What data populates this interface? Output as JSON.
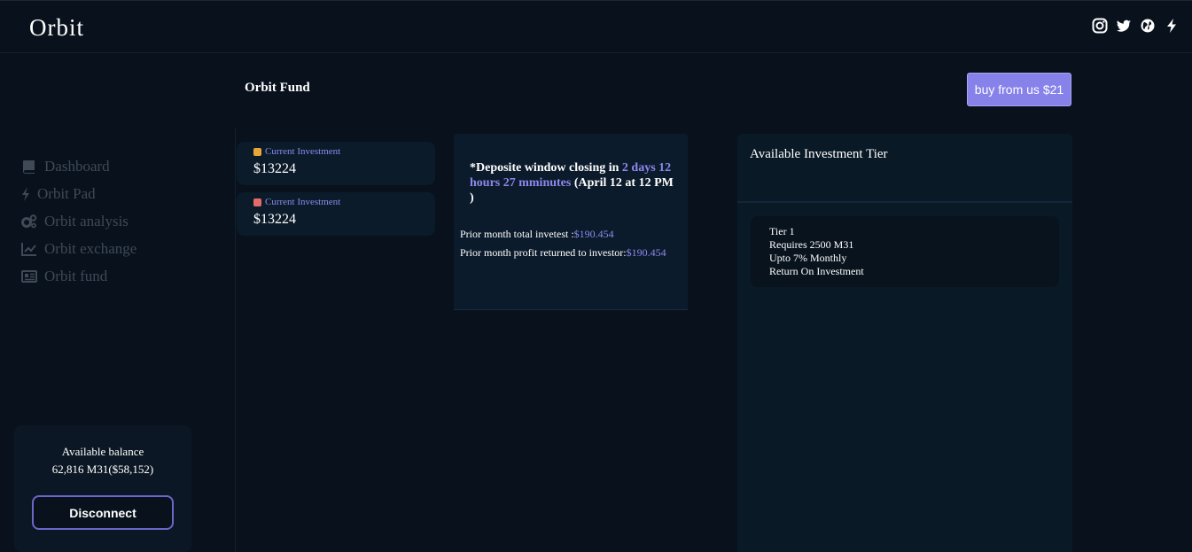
{
  "app": {
    "brand": "Orbit"
  },
  "social": [
    {
      "icon": "instagram-icon"
    },
    {
      "icon": "twitter-icon"
    },
    {
      "icon": "globe-icon"
    },
    {
      "icon": "bolt-icon"
    }
  ],
  "sidebar": {
    "items": [
      {
        "label": "Dashboard",
        "icon": "book-icon"
      },
      {
        "label": "Orbit Pad",
        "icon": "bolt-icon"
      },
      {
        "label": "Orbit analysis",
        "icon": "gears-icon"
      },
      {
        "label": "Orbit exchange",
        "icon": "line-chart-icon"
      },
      {
        "label": "Orbit fund",
        "icon": "newspaper-icon"
      }
    ],
    "balance": {
      "label": "Available balance",
      "value": "62,816 M31($58,152)",
      "disconnect_label": "Disconnect"
    }
  },
  "header": {
    "title": "Orbit Fund",
    "buy_label": "buy from us $21"
  },
  "investments": [
    {
      "label": "Current Investment",
      "value": "$13224",
      "icon_color": "#e8a53a"
    },
    {
      "label": "Current Investment",
      "value": "$13224",
      "icon_color": "#e36b6b"
    }
  ],
  "deposit": {
    "prefix": "*Deposite window closing in ",
    "countdown": "2 days 12 hours 27 mminutes",
    "suffix": " (April 12 at 12 PM )",
    "prior_total_label": "Prior month total invetest :",
    "prior_total_value": "$190.454",
    "prior_profit_label": "Prior month profit returned to investor:",
    "prior_profit_value": "$190.454"
  },
  "tiers": {
    "heading": "Available Investment Tier",
    "items": [
      {
        "name": "Tier 1",
        "requires": "Requires 2500 M31",
        "rate": "Upto 7% Monthly",
        "note": "Return On Investment"
      }
    ]
  },
  "colors": {
    "accent": "#8e88ee",
    "background": "#08111c",
    "card": "#0b1b2a",
    "button": "#8782ea"
  }
}
